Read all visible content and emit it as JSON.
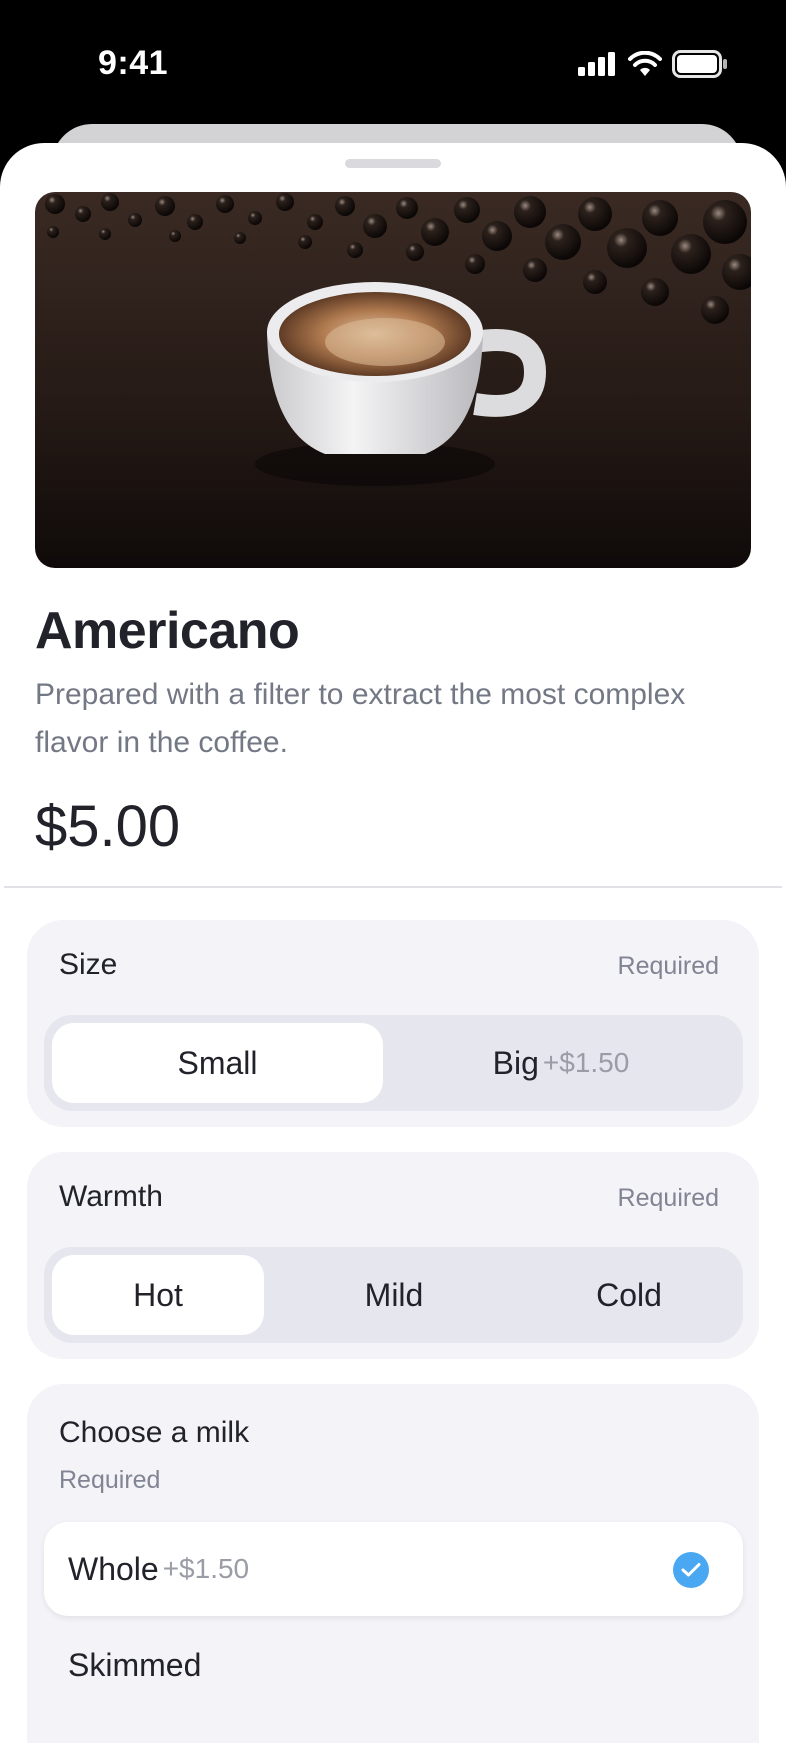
{
  "status_bar": {
    "time": "9:41"
  },
  "product": {
    "title": "Americano",
    "description": "Prepared with a filter to extract the most complex flavor in the coffee.",
    "price": "$5.00"
  },
  "size": {
    "title": "Size",
    "required": "Required",
    "options": [
      {
        "label": "Small",
        "extra": ""
      },
      {
        "label": "Big",
        "extra": "+$1.50"
      }
    ],
    "selected": "Small"
  },
  "warmth": {
    "title": "Warmth",
    "required": "Required",
    "options": [
      {
        "label": "Hot"
      },
      {
        "label": "Mild"
      },
      {
        "label": "Cold"
      }
    ],
    "selected": "Hot"
  },
  "milk": {
    "title": "Choose a milk",
    "required": "Required",
    "options": [
      {
        "label": "Whole",
        "extra": "+$1.50",
        "selected": true
      },
      {
        "label": "Skimmed",
        "extra": "",
        "selected": false
      }
    ]
  },
  "colors": {
    "accent": "#4aa8f2",
    "card_bg": "#f3f3f8",
    "segment_bg": "#e6e6ee"
  }
}
